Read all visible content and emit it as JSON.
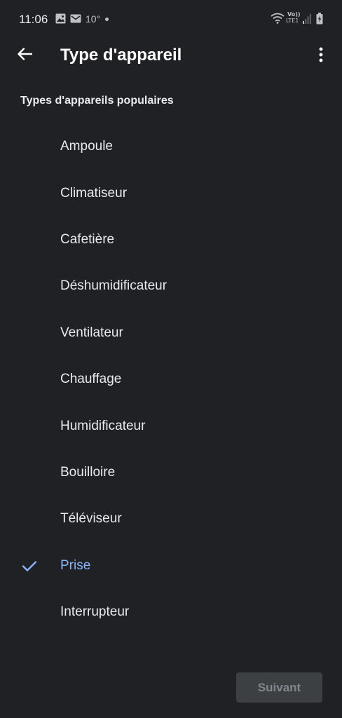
{
  "status_bar": {
    "time": "11:06",
    "temperature": "10°",
    "icons": [
      "image-icon",
      "mail-icon",
      "wifi-icon",
      "volte-lte-icon",
      "signal-icon",
      "battery-charging-icon"
    ],
    "volte_text": "Vo))",
    "lte_text": "LTE1"
  },
  "app_bar": {
    "title": "Type d'appareil",
    "back_icon": "arrow-back-icon",
    "menu_icon": "more-vert-icon"
  },
  "section": {
    "header": "Types d'appareils populaires"
  },
  "devices": [
    {
      "label": "Ampoule",
      "selected": false
    },
    {
      "label": "Climatiseur",
      "selected": false
    },
    {
      "label": "Cafetière",
      "selected": false
    },
    {
      "label": "Déshumidificateur",
      "selected": false
    },
    {
      "label": "Ventilateur",
      "selected": false
    },
    {
      "label": "Chauffage",
      "selected": false
    },
    {
      "label": "Humidificateur",
      "selected": false
    },
    {
      "label": "Bouilloire",
      "selected": false
    },
    {
      "label": "Téléviseur",
      "selected": false
    },
    {
      "label": "Prise",
      "selected": true
    },
    {
      "label": "Interrupteur",
      "selected": false
    }
  ],
  "footer": {
    "next_label": "Suivant",
    "next_enabled": false
  },
  "colors": {
    "background": "#202124",
    "text": "#e8eaed",
    "accent": "#8ab4f8",
    "button_disabled_bg": "#3c4043",
    "button_disabled_text": "#80868b"
  }
}
